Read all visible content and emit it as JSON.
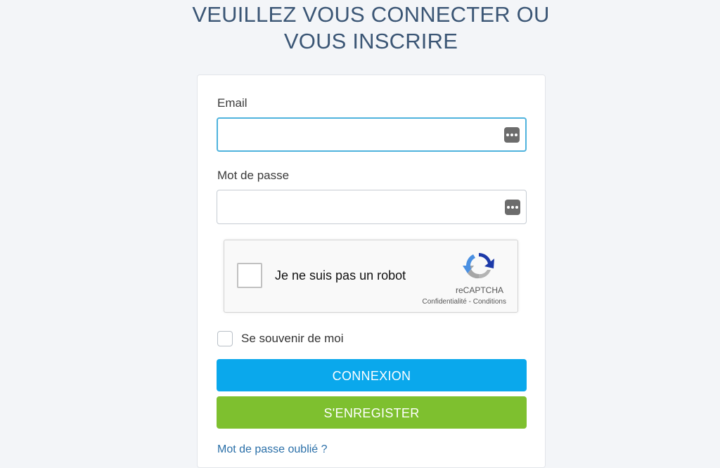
{
  "page": {
    "title_line1": "VEUILLEZ VOUS CONNECTER OU",
    "title_line2": "VOUS INSCRIRE"
  },
  "form": {
    "email_label": "Email",
    "email_value": "",
    "password_label": "Mot de passe",
    "password_value": "",
    "remember_label": "Se souvenir de moi",
    "remember_checked": false,
    "login_button": "CONNEXION",
    "register_button": "S'ENREGISTER",
    "forgot_link": "Mot de passe oublié ?"
  },
  "recaptcha": {
    "label": "Je ne suis pas un robot",
    "brand": "reCAPTCHA",
    "links": "Confidentialité - Conditions",
    "checked": false
  },
  "icons": {
    "password_manager": "password-manager-icon",
    "recaptcha_logo": "recaptcha-logo-icon"
  },
  "colors": {
    "title": "#3b5675",
    "login_button": "#0aa8ec",
    "register_button": "#7ec02f",
    "email_focus_border": "#4fb3dd",
    "link": "#2a6fa8"
  }
}
